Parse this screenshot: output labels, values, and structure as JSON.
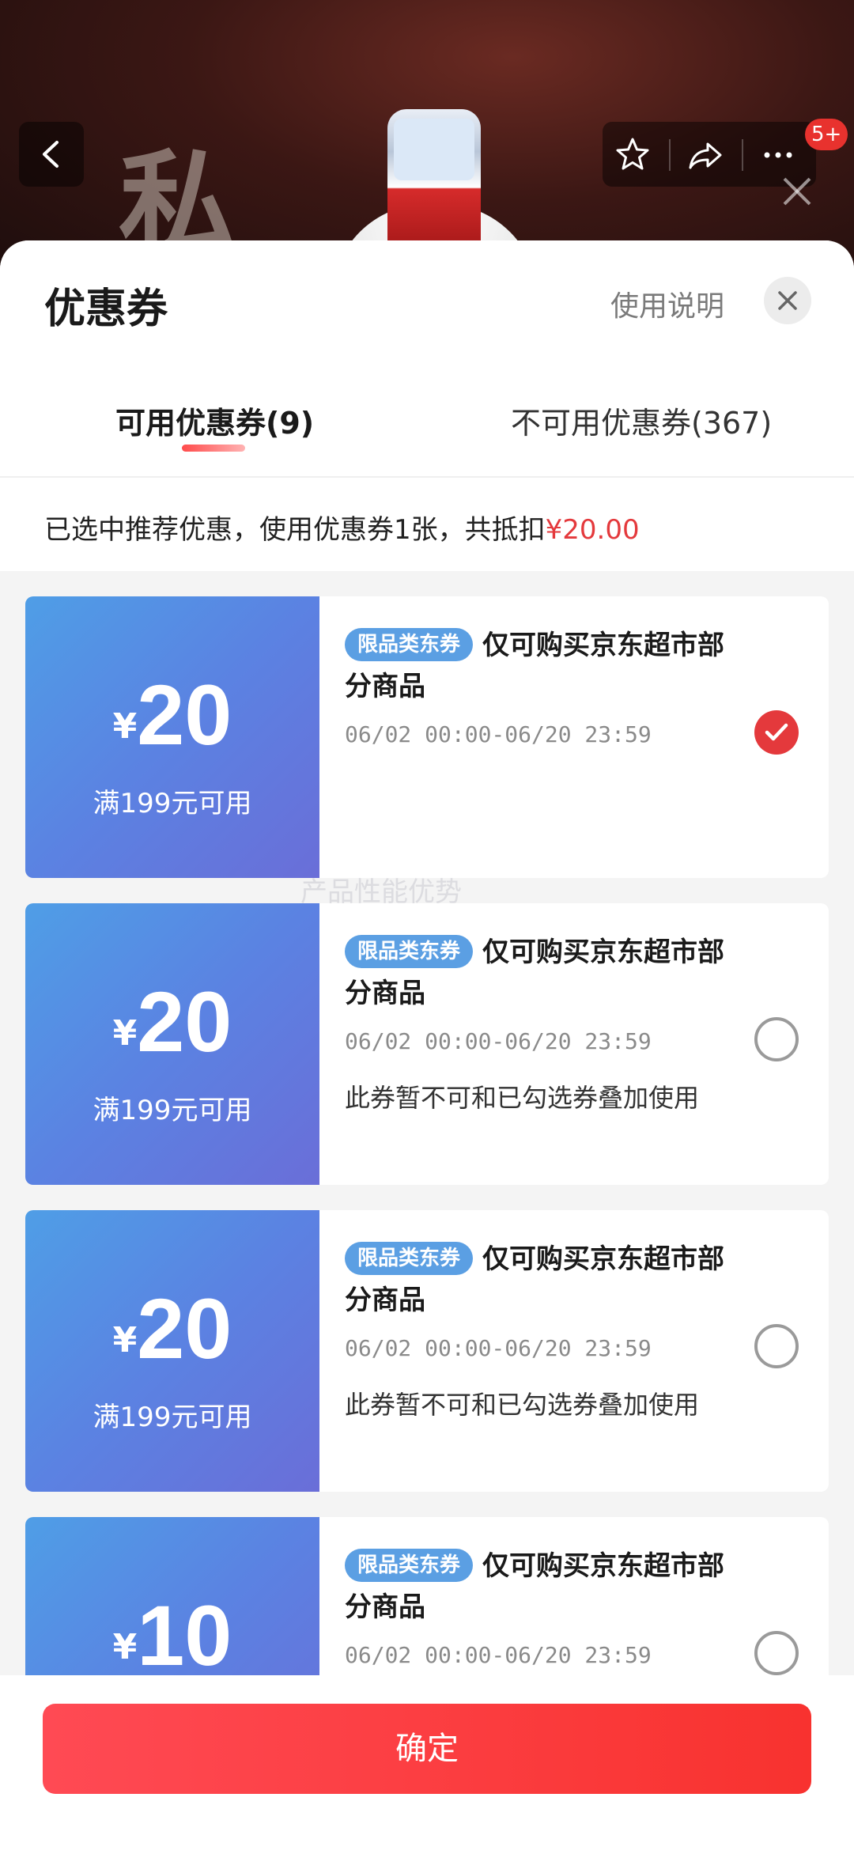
{
  "background": {
    "calligraphy": "私",
    "badge_count": "5+"
  },
  "sheet": {
    "title": "优惠券",
    "usage_link": "使用说明",
    "tabs": [
      {
        "label": "可用优惠券(9)",
        "active": true
      },
      {
        "label": "不可用优惠券(367)",
        "active": false
      }
    ],
    "summary_prefix": "已选中推荐优惠，使用优惠券1张，共抵扣",
    "summary_amount": "¥20.00"
  },
  "coupons": [
    {
      "currency": "¥",
      "amount": "20",
      "threshold": "满199元可用",
      "tag": "限品类东券",
      "desc_line1": "仅可购买京东超市部",
      "desc_line2": "分商品",
      "validity": "06/02 00:00-06/20 23:59",
      "note": "",
      "selected": true
    },
    {
      "currency": "¥",
      "amount": "20",
      "threshold": "满199元可用",
      "tag": "限品类东券",
      "desc_line1": "仅可购买京东超市部",
      "desc_line2": "分商品",
      "validity": "06/02 00:00-06/20 23:59",
      "note": "此券暂不可和已勾选券叠加使用",
      "selected": false
    },
    {
      "currency": "¥",
      "amount": "20",
      "threshold": "满199元可用",
      "tag": "限品类东券",
      "desc_line1": "仅可购买京东超市部",
      "desc_line2": "分商品",
      "validity": "06/02 00:00-06/20 23:59",
      "note": "此券暂不可和已勾选券叠加使用",
      "selected": false
    },
    {
      "currency": "¥",
      "amount": "10",
      "threshold": "",
      "tag": "限品类东券",
      "desc_line1": "仅可购买京东超市部",
      "desc_line2": "分商品",
      "validity": "06/02 00:00-06/20 23:59",
      "note": "",
      "selected": false
    }
  ],
  "watermark": "产品性能优势",
  "footer": {
    "confirm_label": "确定"
  },
  "colors": {
    "accent_red": "#e4393c",
    "coupon_blue": "#5b82e2",
    "tag_blue": "#5b9fe3"
  }
}
